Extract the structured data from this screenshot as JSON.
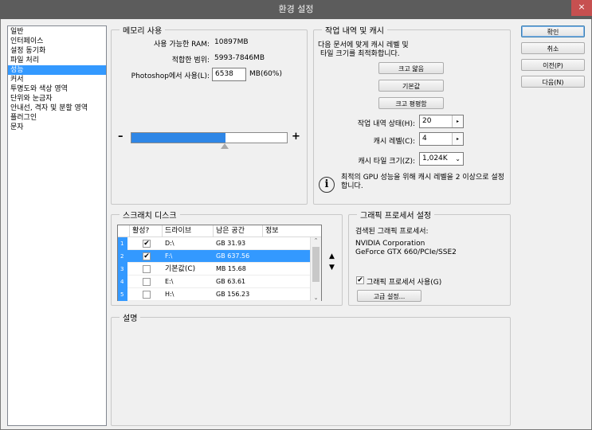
{
  "window": {
    "title": "환경 설정",
    "close_glyph": "×"
  },
  "sidebar": {
    "items": [
      {
        "label": "일반",
        "selected": false
      },
      {
        "label": "인터페이스",
        "selected": false
      },
      {
        "label": "설정 동기화",
        "selected": false
      },
      {
        "label": "파일 처리",
        "selected": false
      },
      {
        "label": "성능",
        "selected": true
      },
      {
        "label": "커서",
        "selected": false
      },
      {
        "label": "투명도와 색상 영역",
        "selected": false
      },
      {
        "label": "단위와 눈금자",
        "selected": false
      },
      {
        "label": "안내선, 격자 및 분할 영역",
        "selected": false
      },
      {
        "label": "플러그인",
        "selected": false
      },
      {
        "label": "문자",
        "selected": false
      }
    ]
  },
  "memory": {
    "legend": "메모리 사용",
    "available_label": "사용 가능한 RAM:",
    "available_value": "10897MB",
    "ideal_label": "적합한 범위:",
    "ideal_value": "5993-7846MB",
    "use_label": "Photoshop에서 사용(L):",
    "use_value": "6538",
    "use_suffix": "MB(60%)",
    "slider_percent": 60,
    "minus": "–",
    "plus": "+"
  },
  "history_cache": {
    "legend": "작업 내역 및 캐시",
    "desc_line1": "다음 문서에 맞게 캐시 레벨 및",
    "desc_line2": "타일 크기를 최적화합니다.",
    "btn_large": "크고 얇음",
    "btn_default": "기본값",
    "btn_huge": "크고 평평함",
    "history_label": "작업 내역 상태(H):",
    "history_value": "20",
    "cache_level_label": "캐시 레벨(C):",
    "cache_level_value": "4",
    "tile_label": "캐시 타일 크기(Z):",
    "tile_value": "1,024K",
    "note_line1": "최적의 GPU 성능을 위해 캐시 레벨을 2 이상으로 설정",
    "note_line2": "합니다.",
    "info_glyph": "i"
  },
  "scratch": {
    "legend": "스크래치 디스크",
    "col_active": "활성?",
    "col_drive": "드라이브",
    "col_free": "남은 공간",
    "col_info": "정보",
    "rows": [
      {
        "num": "1",
        "checked": true,
        "drive": "D:\\",
        "free": "GB 31.93",
        "selected": false
      },
      {
        "num": "2",
        "checked": true,
        "drive": "F:\\",
        "free": "GB 637.56",
        "selected": true
      },
      {
        "num": "3",
        "checked": false,
        "drive": "기본값(C)",
        "free": "MB 15.68",
        "selected": false
      },
      {
        "num": "4",
        "checked": false,
        "drive": "E:\\",
        "free": "GB 63.61",
        "selected": false
      },
      {
        "num": "5",
        "checked": false,
        "drive": "H:\\",
        "free": "GB 156.23",
        "selected": false
      }
    ],
    "move_up": "▲",
    "move_down": "▼",
    "scroll_up": "⌃",
    "scroll_down": "⌄"
  },
  "gpu": {
    "legend": "그래픽 프로세서 설정",
    "detected_label": "검색된 그래픽 프로세서:",
    "vendor": "NVIDIA Corporation",
    "model": "GeForce GTX 660/PCIe/SSE2",
    "use_label": "그래픽 프로세서 사용(G)",
    "use_checked": true,
    "advanced_button": "고급 설정..."
  },
  "description": {
    "legend": "설명"
  },
  "buttons": {
    "ok": "확인",
    "cancel": "취소",
    "prev": "이전(P)",
    "next": "다음(N)"
  },
  "glyphs": {
    "check": "✔",
    "spin_arrow": "▸",
    "chevron": "⌄"
  }
}
